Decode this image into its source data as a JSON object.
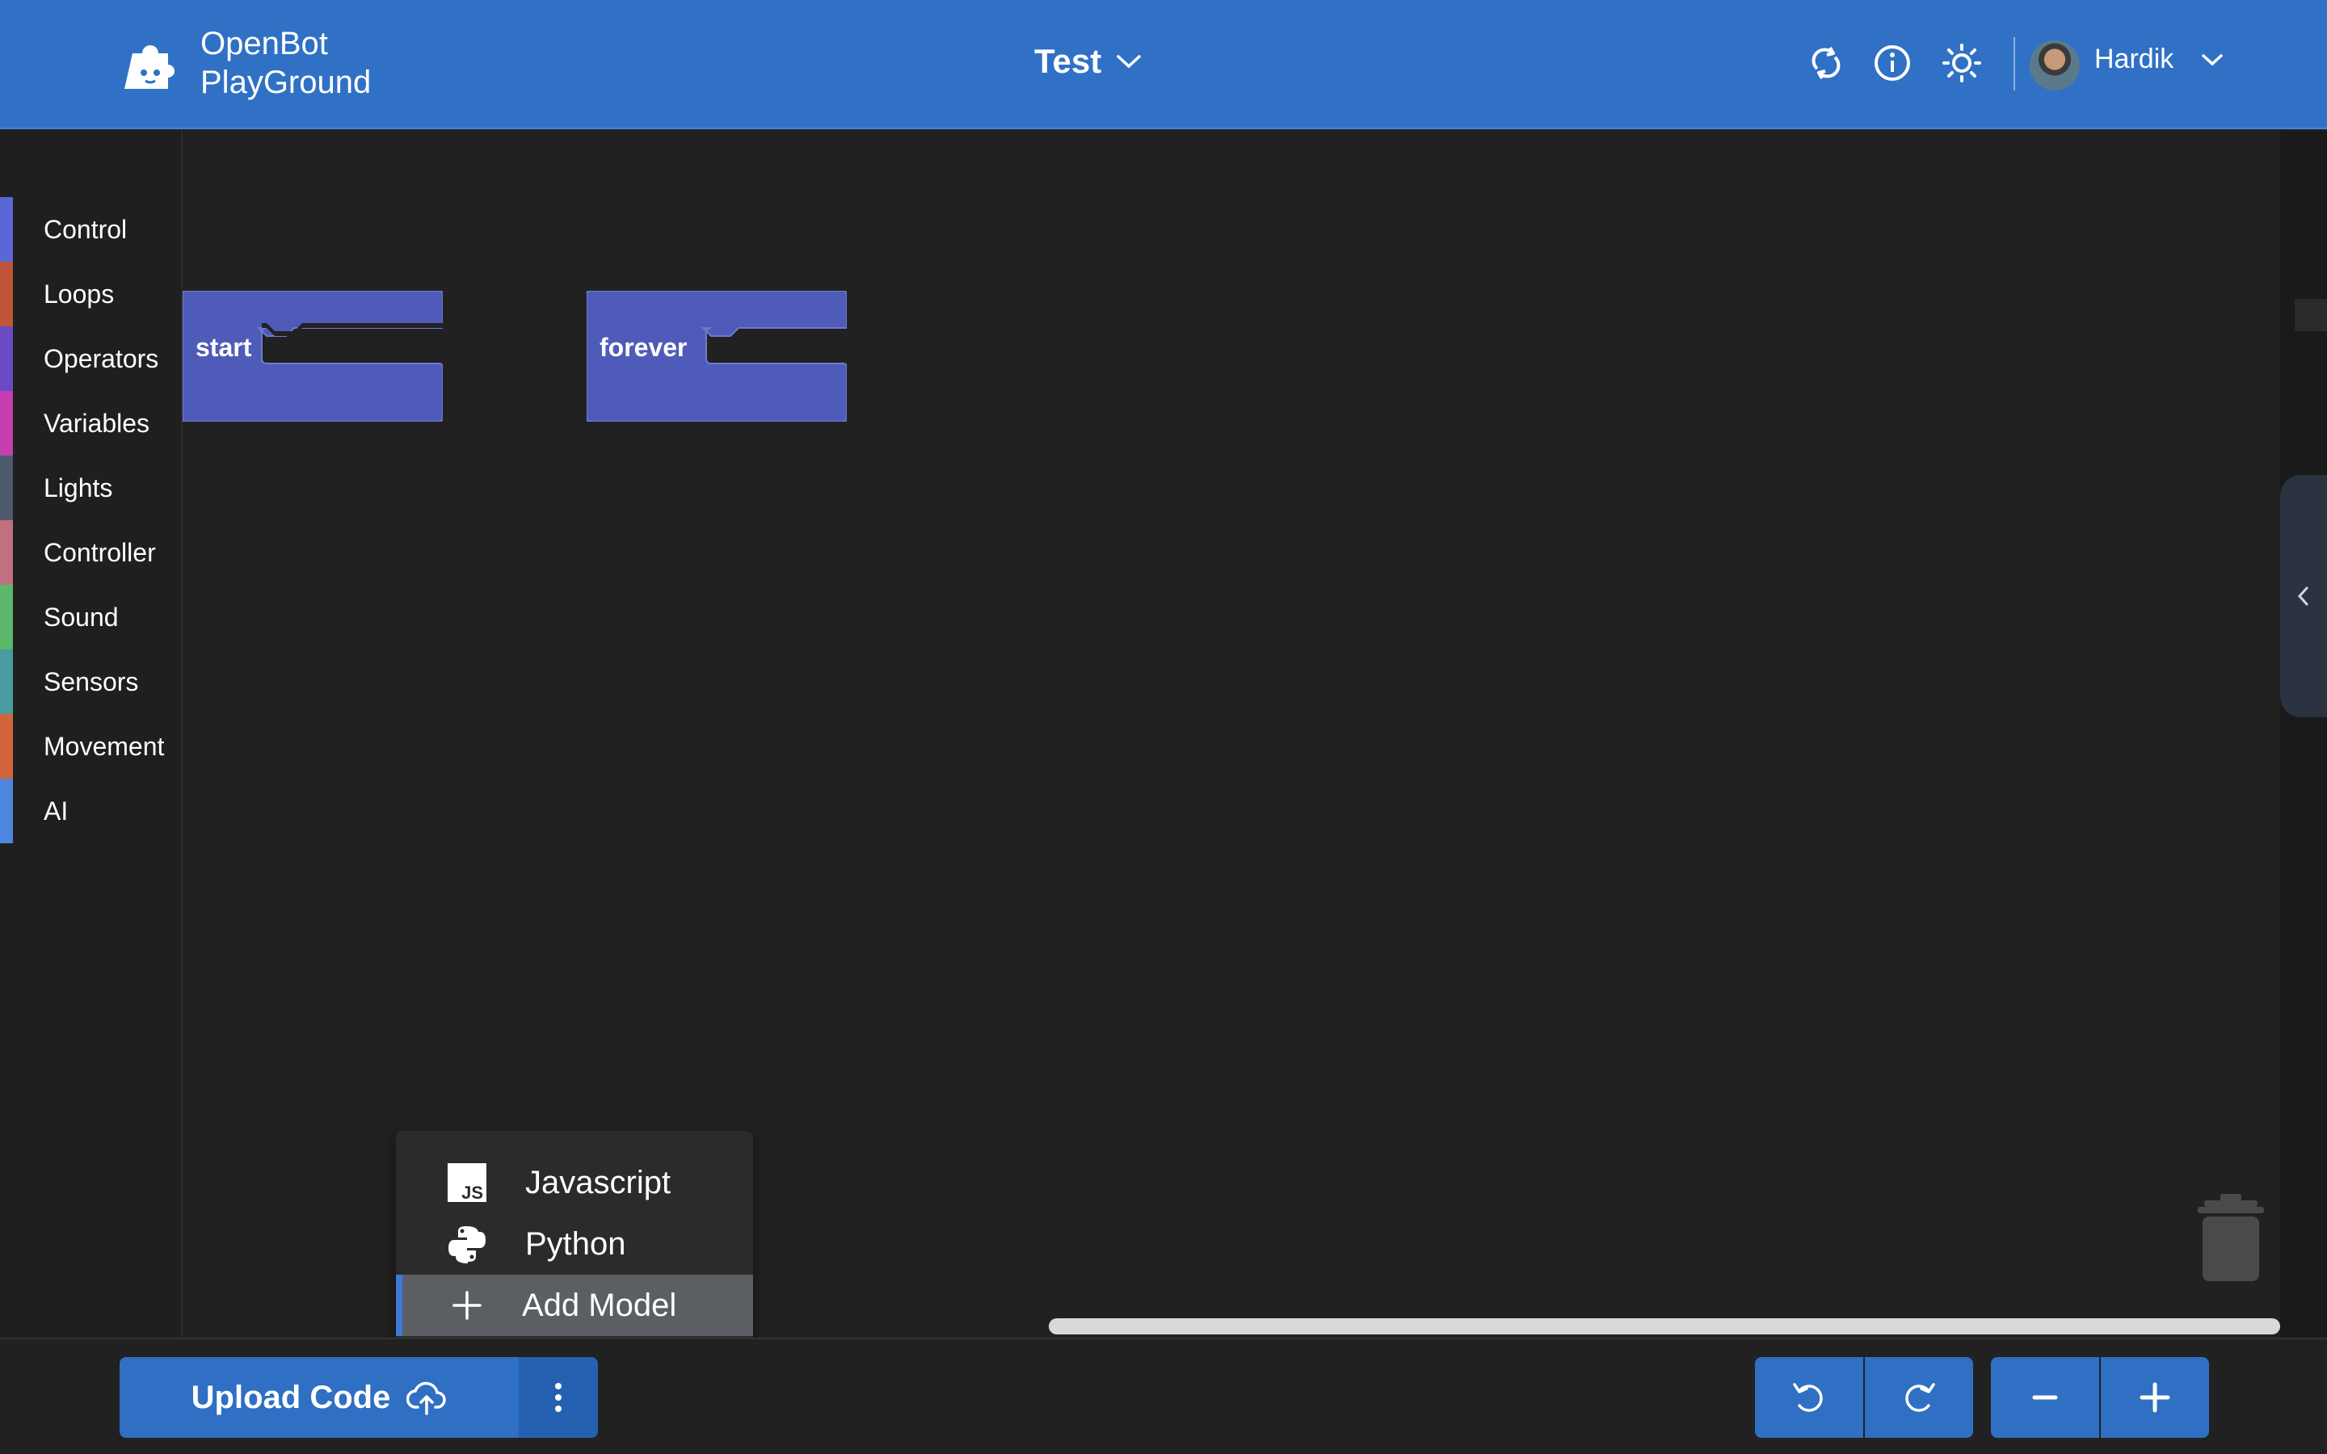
{
  "header": {
    "brand_line1": "OpenBot",
    "brand_line2": "PlayGround",
    "project_name": "Test",
    "user_name": "Hardik",
    "icons": [
      "sync-icon",
      "info-icon",
      "brightness-icon",
      "chevron-down-icon"
    ]
  },
  "sidebar": {
    "items": [
      {
        "label": "Control",
        "color": "#5b67d6"
      },
      {
        "label": "Loops",
        "color": "#c0553a"
      },
      {
        "label": "Operators",
        "color": "#6b4bc4"
      },
      {
        "label": "Variables",
        "color": "#c43fb0"
      },
      {
        "label": "Lights",
        "color": "#4e5a6c"
      },
      {
        "label": "Controller",
        "color": "#c2707f"
      },
      {
        "label": "Sound",
        "color": "#5bb86a"
      },
      {
        "label": "Sensors",
        "color": "#4a9ca0"
      },
      {
        "label": "Movement",
        "color": "#d0653a"
      },
      {
        "label": "AI",
        "color": "#4f86e0"
      }
    ]
  },
  "workspace": {
    "blocks": [
      {
        "label": "start",
        "color": "#4f5bb8"
      },
      {
        "label": "forever",
        "color": "#4f5bb8"
      }
    ]
  },
  "menu": {
    "items": [
      {
        "label": "Javascript",
        "icon": "javascript-icon"
      },
      {
        "label": "Python",
        "icon": "python-icon"
      },
      {
        "label": "Add Model",
        "icon": "plus-icon"
      }
    ]
  },
  "footer": {
    "upload_label": "Upload Code",
    "controls": [
      "undo-icon",
      "redo-icon",
      "zoom-out-icon",
      "zoom-in-icon"
    ]
  },
  "colors": {
    "header_blue": "#3071c5",
    "button_blue": "#2f6fc4",
    "canvas": "#212121"
  }
}
